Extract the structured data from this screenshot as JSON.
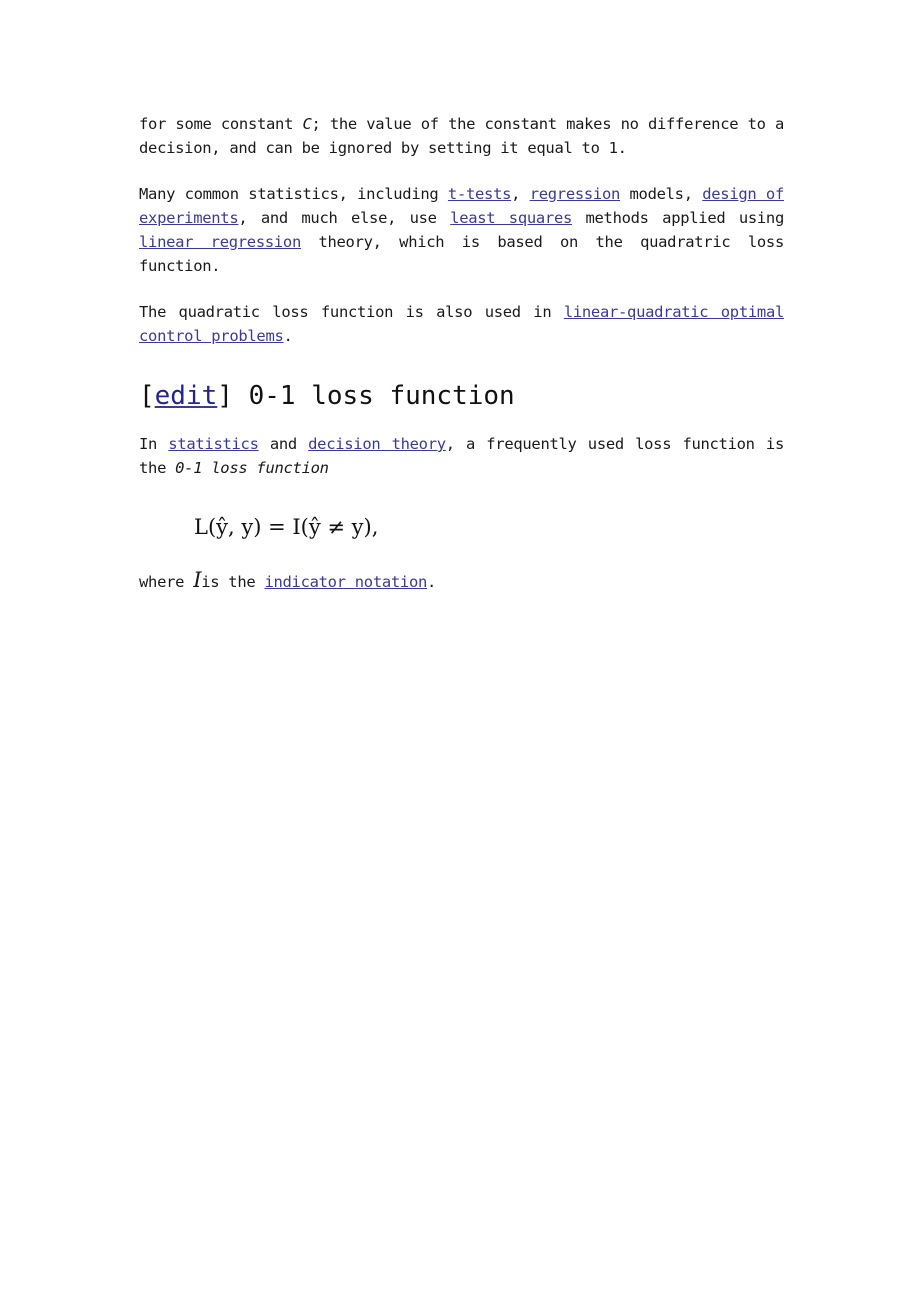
{
  "paragraphs": {
    "p1": {
      "t1": "for some constant ",
      "var_c": "C",
      "t2": "; the value of the constant makes no difference to a decision, and can be ignored by setting it equal to 1."
    },
    "p2": {
      "t1": "Many common statistics, including ",
      "link_ttests": "t-tests",
      "t2": ", ",
      "link_regression": "regression",
      "t3": " models, ",
      "link_design": "design of experiments",
      "t4": ", and much else, use ",
      "link_least_squares": "least squares",
      "t5": " methods applied using ",
      "link_linear_regression": "linear regression",
      "t6": " theory, which is based on the quadratric loss function."
    },
    "p3": {
      "t1": "The quadratic loss function is also used in ",
      "link_lq": "linear-quadratic optimal control problems",
      "t2": "."
    },
    "heading": {
      "bracket_open": "[",
      "edit": "edit",
      "bracket_close": "]",
      "title": " 0-1 loss function"
    },
    "p4": {
      "t1": "In ",
      "link_statistics": "statistics",
      "t2": " and ",
      "link_decision_theory": "decision theory",
      "t3": ", a frequently used loss function is the ",
      "em": "0-1 loss function"
    },
    "formula": "L(ŷ, y) = I(ŷ ≠ y),",
    "p5": {
      "t1": "where ",
      "var_i": "I",
      "t2": "is the ",
      "link_indicator": "indicator notation",
      "t3": "."
    }
  }
}
